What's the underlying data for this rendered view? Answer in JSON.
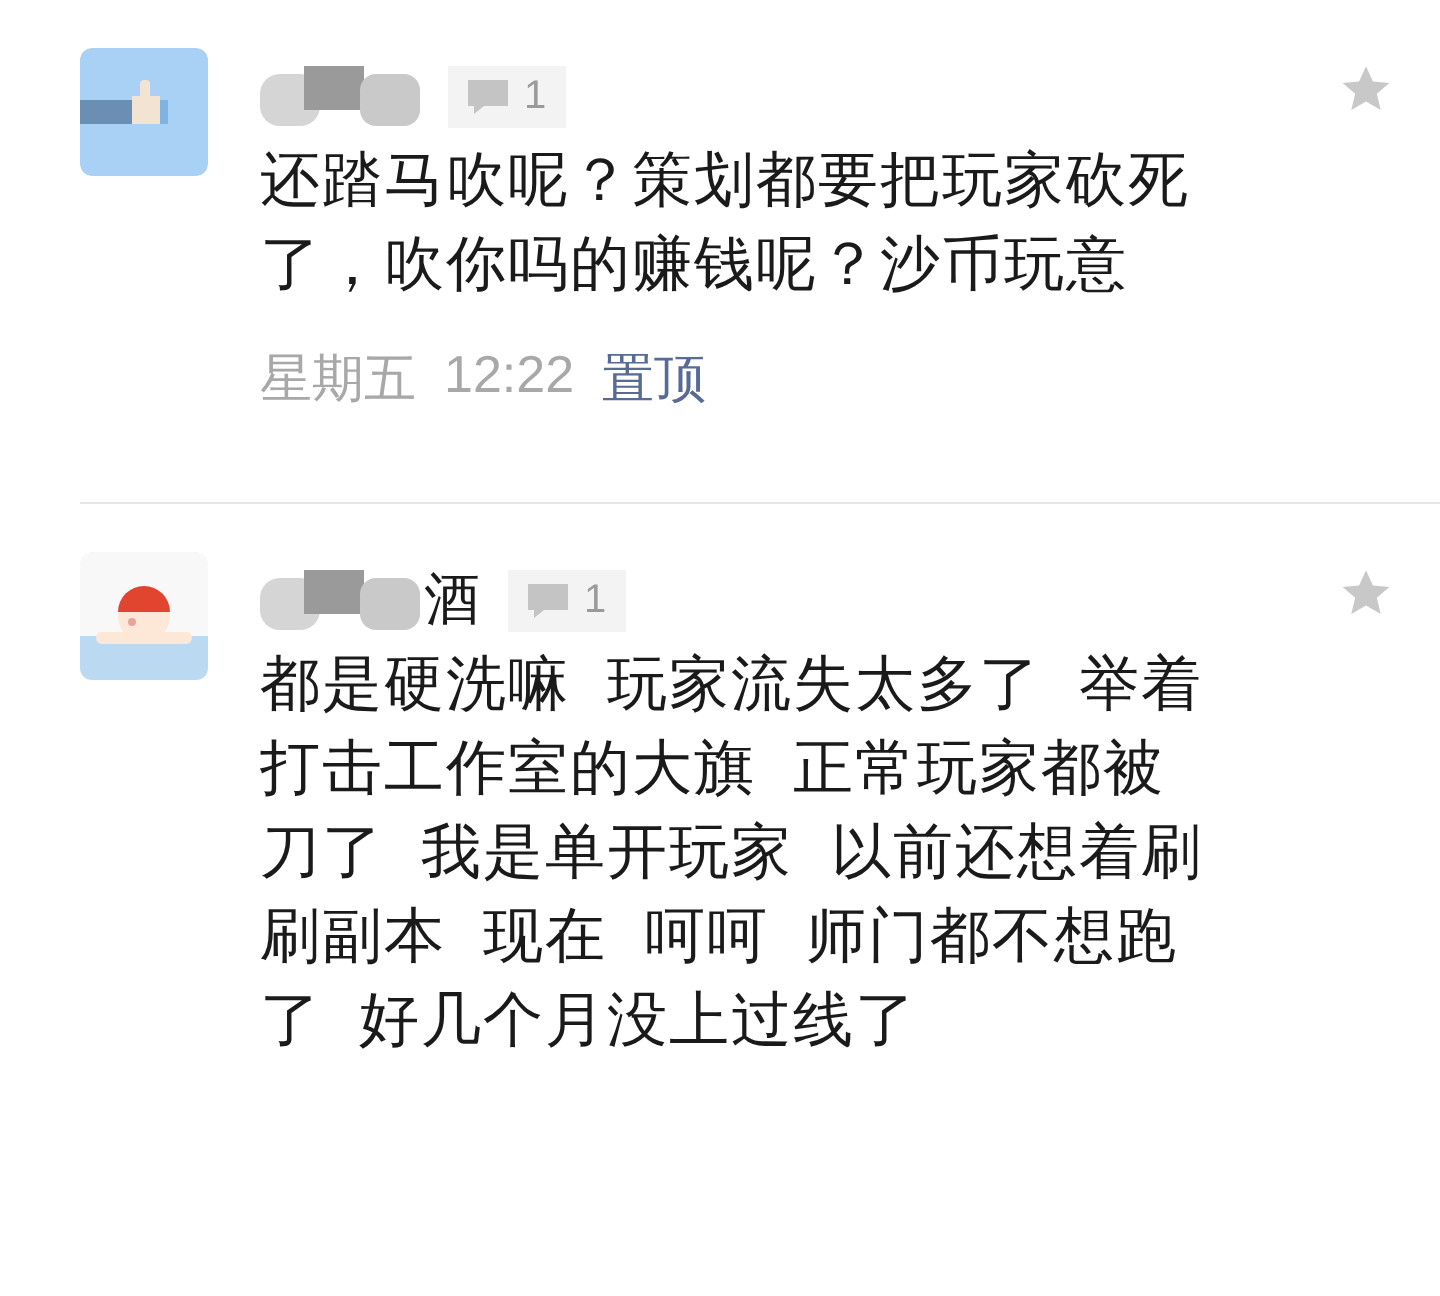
{
  "comments": [
    {
      "avatar": {
        "kind": "thumb"
      },
      "reply_count": "1",
      "text": "还踏马吹呢？策划都要把玩家砍死了，吹你吗的赚钱呢？沙币玩意",
      "time": "星期五",
      "clock": "12:22",
      "action": "置顶"
    },
    {
      "avatar": {
        "kind": "swimmer"
      },
      "author": "酒",
      "reply_count": "1",
      "text": "都是硬洗嘛  玩家流失太多了  举着打击工作室的大旗  正常玩家都被刀了  我是单开玩家  以前还想着刷刷副本  现在  呵呵  师门都不想跑了  好几个月没上过线了"
    }
  ]
}
